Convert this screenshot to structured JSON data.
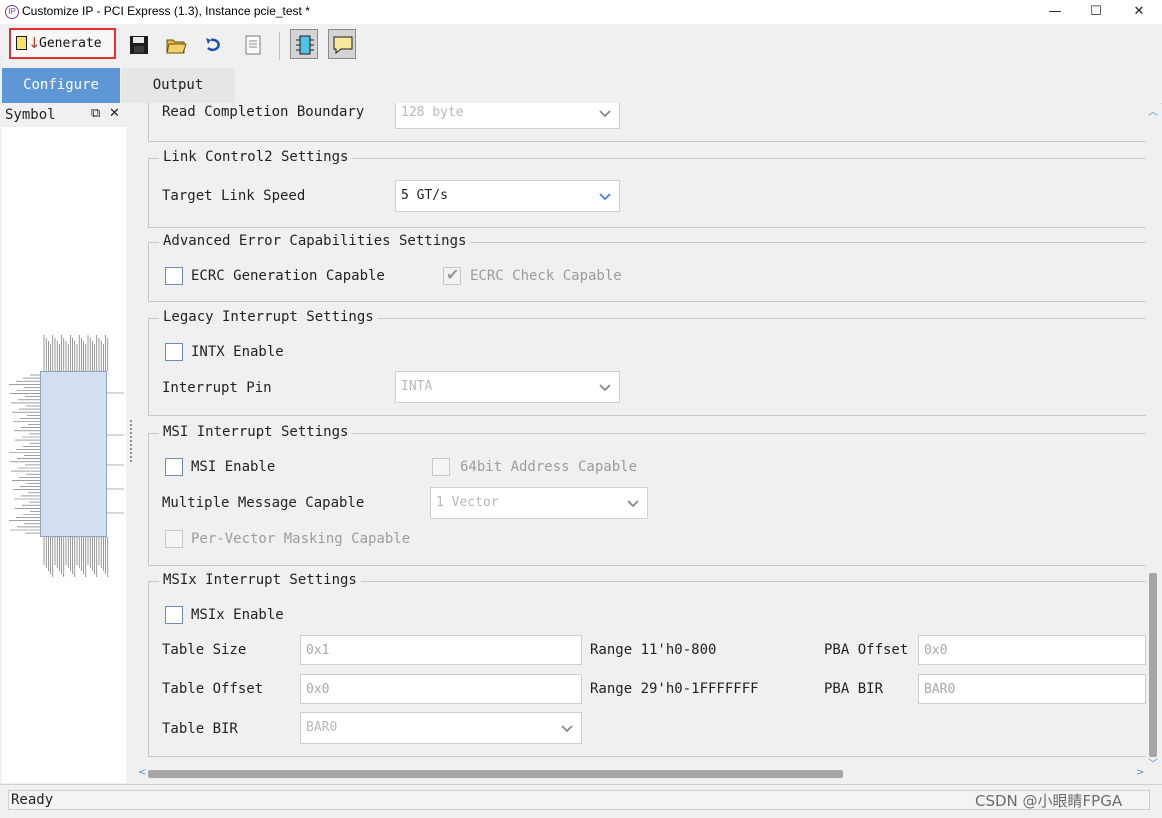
{
  "window": {
    "title": "Customize IP - PCI Express (1.3), Instance pcie_test *",
    "minimize": "—",
    "maximize": "☐",
    "close": "✕"
  },
  "toolbar": {
    "generate_label": "Generate",
    "icons": [
      "save-icon",
      "open-folder-icon",
      "refresh-icon",
      "document-icon",
      "chip-view-icon",
      "comment-icon"
    ]
  },
  "tabs": [
    {
      "label": "Configure",
      "active": true
    },
    {
      "label": "Output",
      "active": false
    }
  ],
  "symbol_panel": {
    "title": "Symbol",
    "restore_icon": "⧉",
    "close_icon": "✕"
  },
  "sections": {
    "rcb": {
      "label": "Read Completion Boundary",
      "value": "128 byte"
    },
    "link_control2": {
      "title": "Link Control2 Settings",
      "target_link_speed_label": "Target Link Speed",
      "target_link_speed_value": "5 GT/s"
    },
    "advanced_error": {
      "title": "Advanced Error Capabilities Settings",
      "ecrc_gen_label": "ECRC Generation Capable",
      "ecrc_check_label": "ECRC Check Capable"
    },
    "legacy_interrupt": {
      "title": "Legacy Interrupt Settings",
      "intx_label": "INTX Enable",
      "interrupt_pin_label": "Interrupt Pin",
      "interrupt_pin_value": "INTA"
    },
    "msi": {
      "title": "MSI Interrupt Settings",
      "msi_enable_label": "MSI Enable",
      "addr64_label": "64bit Address Capable",
      "multi_msg_label": "Multiple Message Capable",
      "multi_msg_value": "1 Vector",
      "per_vector_label": "Per-Vector Masking Capable"
    },
    "msix": {
      "title": "MSIx Interrupt Settings",
      "msix_enable_label": "MSIx Enable",
      "table_size_label": "Table Size",
      "table_size_value": "0x1",
      "table_size_range": "Range 11'h0-800",
      "pba_offset_label": "PBA Offset",
      "pba_offset_value": "0x0",
      "table_offset_label": "Table Offset",
      "table_offset_value": "0x0",
      "table_offset_range": "Range 29'h0-1FFFFFFF",
      "pba_bir_label": "PBA BIR",
      "pba_bir_value": "BAR0",
      "table_bir_label": "Table BIR",
      "table_bir_value": "BAR0"
    }
  },
  "status": {
    "text": "Ready"
  },
  "watermark": "CSDN @小眼睛FPGA",
  "colors": {
    "active_tab": "#5e97d5",
    "generate_highlight": "#e3302f",
    "chip_fill": "#d3dff0"
  }
}
